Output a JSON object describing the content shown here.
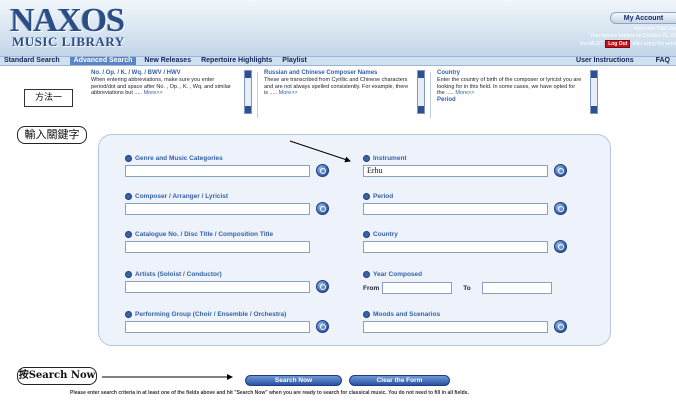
{
  "header": {
    "logo_top": "NAXOS",
    "logo_bottom": "MUSIC LIBRARY",
    "account_label": "My Account",
    "welcome": "Welcome Trial Use",
    "licence": "Your licence expires on October 31, 20",
    "must_prefix": "You MUST",
    "logout_label": "Log Out",
    "must_suffix": "after using the servi"
  },
  "nav": {
    "items": [
      "Standard Search",
      "Advanced Search",
      "New Releases",
      "Repertoire Highlights",
      "Playlist"
    ],
    "active_index": 1,
    "right": [
      "User Instructions",
      "FAQ"
    ]
  },
  "callouts": {
    "method": "方法一",
    "input_keywords": "輸入關鍵字",
    "press_prefix": "按",
    "press_search": "Search Now"
  },
  "info": [
    {
      "title": "No. / Op. / K. / Wq. / BWV / HWV",
      "text": "When entering abbreviations, make sure you enter period/dot and space after No. , Op. , K. , Wq. and similar abbreviations but .....",
      "more": "More>>"
    },
    {
      "title": "Russian and Chinese Composer Names",
      "text": "These are transcribed from Cyrillic and Chinese characters and are not always spelled consistently. For example, there is .....",
      "more": "More>>"
    },
    {
      "title": "Country",
      "text": "Enter the country of birth of the composer or lyricist you are looking for in this field. In some cases, we have opted for the .....",
      "more": "More>>",
      "extra": "Period"
    }
  ],
  "fields": {
    "genre": {
      "label": "Genre and Music Categories",
      "value": ""
    },
    "composer": {
      "label": "Composer / Arranger / Lyricist",
      "value": ""
    },
    "catalogue": {
      "label": "Catalogue No. / Disc Title / Composition Title",
      "value": ""
    },
    "artists": {
      "label": "Artists (Soloist / Conductor)",
      "value": ""
    },
    "group": {
      "label": "Performing Group (Choir / Ensemble / Orchestra)",
      "value": ""
    },
    "instrument": {
      "label": "Instrument",
      "value": "Erhu"
    },
    "period": {
      "label": "Period",
      "value": ""
    },
    "country": {
      "label": "Country",
      "value": ""
    },
    "year": {
      "label": "Year Composed",
      "from_label": "From",
      "to_label": "To",
      "from_value": "",
      "to_value": ""
    },
    "moods": {
      "label": "Moods and Scenarios",
      "value": ""
    }
  },
  "actions": {
    "search_now": "Search Now",
    "clear_form": "Clear the Form"
  },
  "footer": "Please enter search criteria in at least one of the fields above and hit \"Search Now\" when you are ready to search for classical music. You do not need to fill in all fields.",
  "colors": {
    "accent": "#3561a6",
    "nav_bg": "#cfe0f0",
    "panel_bg": "#eef3fb",
    "logout": "#c8101a"
  }
}
